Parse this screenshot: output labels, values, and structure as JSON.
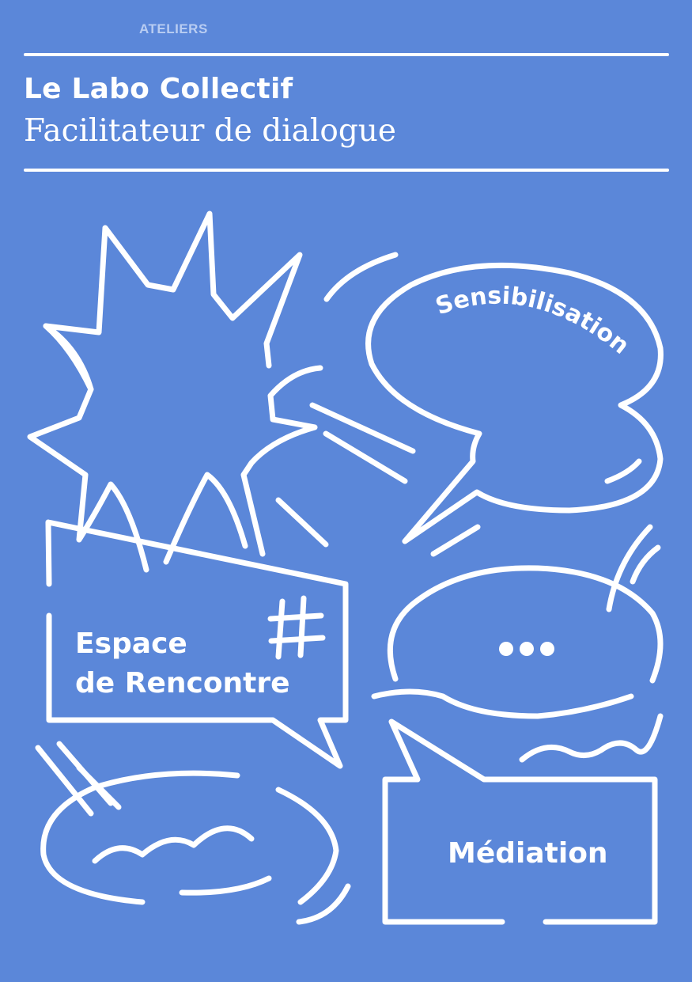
{
  "header": {
    "kicker": "ATELIERS",
    "title": "Le Labo Collectif",
    "subtitle": "Facilitateur de dialogue"
  },
  "bubbles": {
    "sensibilisation": "Sensibilisation",
    "espace_line1": "Espace",
    "espace_line2": "de Rencontre",
    "hashtag": "#",
    "mediation": "Médiation"
  },
  "colors": {
    "background": "#5b87d9",
    "foreground": "#ffffff",
    "kicker": "#b9cdf2"
  }
}
